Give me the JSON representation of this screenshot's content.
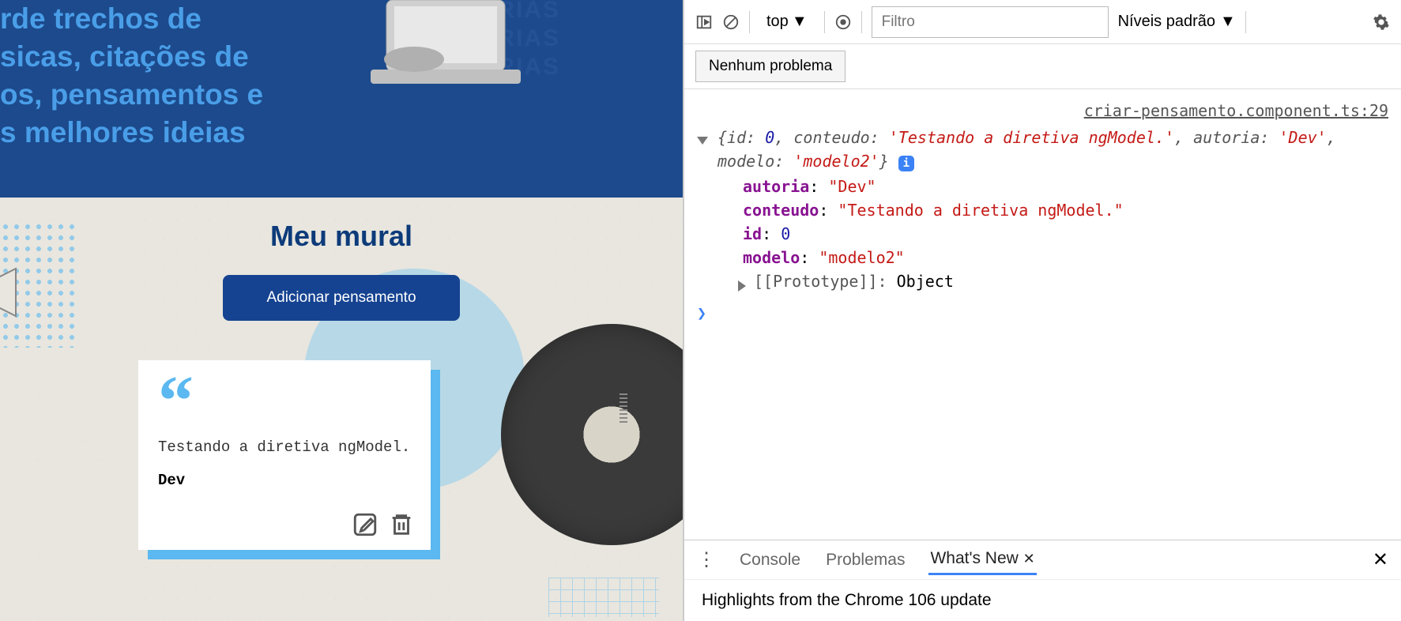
{
  "app": {
    "hero": {
      "lines": [
        "rde trechos de",
        "sicas, citações de",
        "os, pensamentos e",
        "s melhores ideias"
      ],
      "bg_word": "MEMÓRIAS"
    },
    "mural": {
      "title": "Meu mural",
      "add_button": "Adicionar pensamento"
    },
    "card": {
      "content": "Testando a diretiva ngModel.",
      "author": "Dev"
    }
  },
  "devtools": {
    "toolbar": {
      "context": "top",
      "filter_placeholder": "Filtro",
      "levels_label": "Níveis padrão"
    },
    "issues_button": "Nenhum problema",
    "console": {
      "source": "criar-pensamento.component.ts:29",
      "summary": "{id: 0, conteudo: 'Testando a diretiva ngModel.', autoria: 'Dev', modelo: 'modelo2'}",
      "props": {
        "autoria": "\"Dev\"",
        "conteudo": "\"Testando a diretiva ngModel.\"",
        "id": "0",
        "modelo": "\"modelo2\""
      },
      "prototype_label": "[[Prototype]]:",
      "prototype_value": "Object"
    },
    "drawer": {
      "tabs": {
        "console": "Console",
        "problems": "Problemas",
        "whatsnew": "What's New"
      },
      "content": "Highlights from the Chrome 106 update"
    }
  },
  "chart_data": null
}
